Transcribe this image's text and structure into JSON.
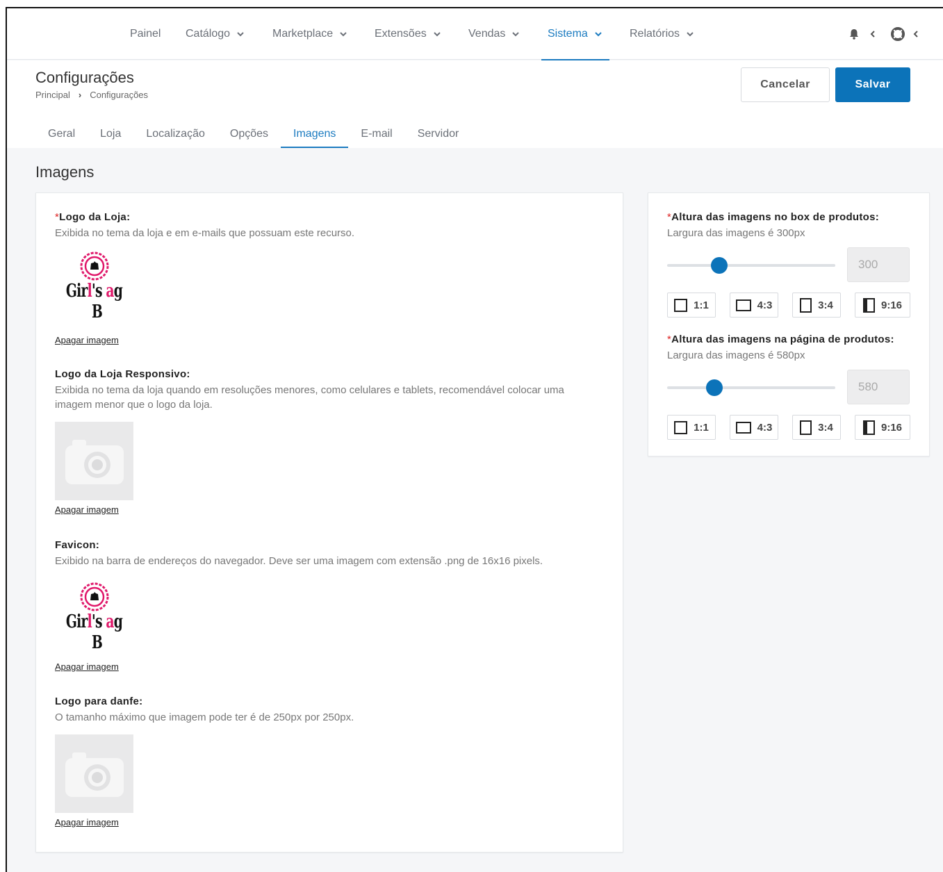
{
  "nav": {
    "items": [
      {
        "label": "Painel",
        "dropdown": false
      },
      {
        "label": "Catálogo",
        "dropdown": true
      },
      {
        "label": "Marketplace",
        "dropdown": true
      },
      {
        "label": "Extensões",
        "dropdown": true
      },
      {
        "label": "Vendas",
        "dropdown": true
      },
      {
        "label": "Sistema",
        "dropdown": true,
        "active": true
      },
      {
        "label": "Relatórios",
        "dropdown": true
      }
    ],
    "icons": [
      "bell-icon",
      "support-lifebuoy-icon"
    ]
  },
  "header": {
    "title": "Configurações",
    "breadcrumb": [
      "Principal",
      "Configurações"
    ],
    "cancel_label": "Cancelar",
    "save_label": "Salvar"
  },
  "tabs": [
    {
      "label": "Geral"
    },
    {
      "label": "Loja"
    },
    {
      "label": "Localização"
    },
    {
      "label": "Opções"
    },
    {
      "label": "Imagens",
      "active": true
    },
    {
      "label": "E-mail"
    },
    {
      "label": "Servidor"
    }
  ],
  "section_title": "Imagens",
  "images": {
    "logo": {
      "required_mark": "*",
      "label": "Logo da Loja:",
      "desc": "Exibida no tema da loja e em e-mails que possuam este recurso.",
      "delete_label": "Apagar imagem",
      "brand_text_a": "Gir",
      "brand_text_b": "l",
      "brand_text_c": "'s B",
      "brand_text_d": "a",
      "brand_text_e": "g"
    },
    "logo_responsive": {
      "label": "Logo da Loja Responsivo:",
      "desc": "Exibida no tema da loja quando em resoluções menores, como celulares e tablets, recomendável colocar uma imagem menor que o logo da loja.",
      "delete_label": "Apagar imagem"
    },
    "favicon": {
      "label": "Favicon:",
      "desc": "Exibido na barra de endereços do navegador. Deve ser uma imagem com extensão .png de 16x16 pixels.",
      "delete_label": "Apagar imagem"
    },
    "danfe": {
      "label": "Logo para danfe:",
      "desc": "O tamanho máximo que imagem pode ter é de 250px por 250px.",
      "delete_label": "Apagar imagem"
    }
  },
  "heights": {
    "box": {
      "required_mark": "*",
      "label": "Altura das imagens no box de produtos:",
      "desc": "Largura das imagens é 300px",
      "value": "300",
      "slider_fraction": 0.31
    },
    "page": {
      "required_mark": "*",
      "label": "Altura das imagens na página de produtos:",
      "desc": "Largura das imagens é 580px",
      "value": "580",
      "slider_fraction": 0.28
    },
    "ratios": [
      "1:1",
      "4:3",
      "3:4",
      "9:16"
    ]
  },
  "colors": {
    "accent": "#0c73b9",
    "brand_pink": "#e0196b"
  }
}
